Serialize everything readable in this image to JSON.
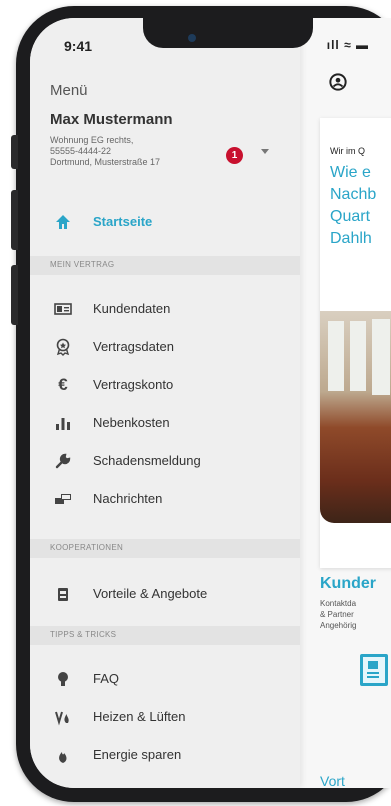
{
  "status": {
    "time": "9:41",
    "icons": "ıll ≈ ▬"
  },
  "drawer": {
    "title": "Menü",
    "user_name": "Max Mustermann",
    "address": "Wohnung EG rechts,\n55555-4444-22\nDortmund, Musterstraße 17",
    "badge_count": "1",
    "home": {
      "label": "Startseite",
      "icon": "home-icon"
    },
    "sections": {
      "contract": "MEIN VERTRAG",
      "coop": "KOOPERATIONEN",
      "tips": "TIPPS & TRICKS"
    },
    "items": [
      {
        "label": "Kundendaten",
        "icon": "id-card-icon"
      },
      {
        "label": "Vertragsdaten",
        "icon": "award-icon"
      },
      {
        "label": "Vertragskonto",
        "icon": "euro-icon"
      },
      {
        "label": "Nebenkosten",
        "icon": "bar-chart-icon"
      },
      {
        "label": "Schadensmeldung",
        "icon": "wrench-icon"
      },
      {
        "label": "Nachrichten",
        "icon": "messages-icon"
      },
      {
        "label": "Vorteile & Angebote",
        "icon": "gift-icon"
      },
      {
        "label": "FAQ",
        "icon": "lightbulb-icon"
      },
      {
        "label": "Heizen & Lüften",
        "icon": "heating-icon"
      },
      {
        "label": "Energie sparen",
        "icon": "flame-icon"
      }
    ]
  },
  "main": {
    "card1": {
      "subtitle": "Wir im Q",
      "heading": "Wie e\nNachb\nQuart\nDahlh"
    },
    "card2": {
      "heading": "Kunder",
      "text": "Kontaktda\n& Partner\nAngehörig"
    },
    "card3": {
      "heading": "Vort"
    }
  },
  "colors": {
    "accent": "#2aa5c8",
    "badge": "#c8102e"
  }
}
